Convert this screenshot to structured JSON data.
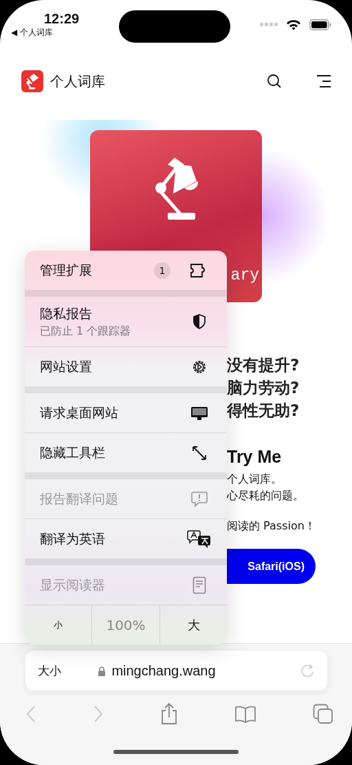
{
  "status_bar": {
    "time": "12:29",
    "back_label": "◀ 个人词库"
  },
  "site_header": {
    "title": "个人词库"
  },
  "hero": {
    "card_text": "ary"
  },
  "headlines": [
    "没有提升?",
    "脑力劳动?",
    "得性无助?"
  ],
  "try_me": {
    "title": "Try Me",
    "lines": [
      "个人词库。",
      "心尽耗的问题。"
    ],
    "passion": "阅读的 Passion！",
    "button": "Safari(iOS)"
  },
  "menu": {
    "groups": [
      [
        {
          "kind": "extensions",
          "label": "管理扩展",
          "badge": "1",
          "disabled": false
        }
      ],
      [
        {
          "kind": "privacy",
          "label": "隐私报告",
          "subtitle": "已防止 1 个跟踪器",
          "disabled": false
        },
        {
          "kind": "settings",
          "label": "网站设置",
          "disabled": false
        }
      ],
      [
        {
          "kind": "desktop",
          "label": "请求桌面网站",
          "disabled": false
        },
        {
          "kind": "toolbar",
          "label": "隐藏工具栏",
          "disabled": false
        }
      ],
      [
        {
          "kind": "report",
          "label": "报告翻译问题",
          "disabled": true
        },
        {
          "kind": "translate",
          "label": "翻译为英语",
          "disabled": false
        }
      ],
      [
        {
          "kind": "reader",
          "label": "显示阅读器",
          "disabled": true
        }
      ]
    ],
    "zoom": {
      "smaller": "小",
      "percent": "100%",
      "larger": "大"
    }
  },
  "address_bar": {
    "format_button": "大小",
    "url": "mingchang.wang"
  }
}
